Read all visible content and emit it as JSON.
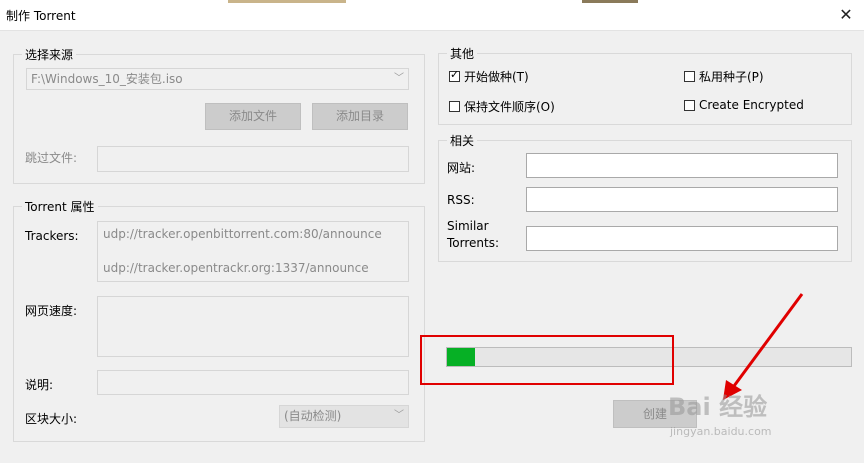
{
  "window": {
    "title": "制作 Torrent",
    "close_symbol": "✕"
  },
  "source": {
    "legend": "选择来源",
    "path_value": "F:\\Windows_10_安装包.iso",
    "add_file_label": "添加文件",
    "add_dir_label": "添加目录",
    "skip_files_label": "跳过文件:"
  },
  "props": {
    "legend": "Torrent 属性",
    "trackers_label": "Trackers:",
    "trackers": [
      "udp://tracker.openbittorrent.com:80/announce",
      "udp://tracker.opentrackr.org:1337/announce"
    ],
    "web_seeds_label": "网页速度:",
    "comment_label": "说明:",
    "piece_size_label": "区块大小:",
    "piece_size_value": "(自动检测)"
  },
  "other": {
    "legend": "其他",
    "start_seeding": {
      "label": "开始做种(T)",
      "checked": true
    },
    "private": {
      "label": "私用种子(P)",
      "checked": false
    },
    "preserve_order": {
      "label": "保持文件顺序(O)",
      "checked": false
    },
    "create_encrypted": {
      "label": "Create Encrypted",
      "checked": false
    }
  },
  "related": {
    "legend": "相关",
    "website_label": "网站:",
    "rss_label": "RSS:",
    "similar_label_1": "Similar",
    "similar_label_2": "Torrents:"
  },
  "progress": {
    "value": 0.07,
    "color": "#06b025"
  },
  "create_button_label": "创建",
  "watermark": {
    "brand": "Bai  经验",
    "url": "jingyan.baidu.com"
  },
  "colors": {
    "annotation": "#e00000"
  }
}
